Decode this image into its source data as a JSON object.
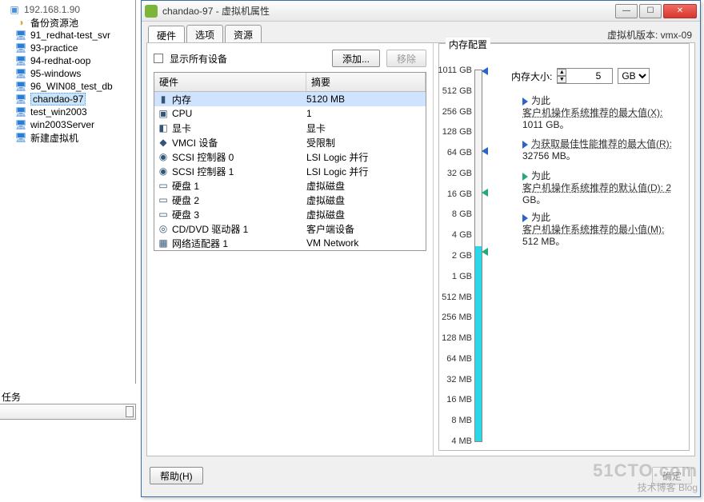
{
  "tree": {
    "root": "192.168.1.90",
    "pool": "备份资源池",
    "vms": [
      {
        "name": "91_redhat-test_svr",
        "sel": false
      },
      {
        "name": "93-practice",
        "sel": false
      },
      {
        "name": "94-redhat-oop",
        "sel": false
      },
      {
        "name": "95-windows",
        "sel": false
      },
      {
        "name": "96_WIN08_test_db",
        "sel": false
      },
      {
        "name": "chandao-97",
        "sel": true
      },
      {
        "name": "test_win2003",
        "sel": false
      },
      {
        "name": "win2003Server",
        "sel": false
      }
    ],
    "newvm": "新建虚拟机"
  },
  "tasks_label": "任务",
  "dialog": {
    "title": "chandao-97 - 虚拟机属性",
    "version": "虚拟机版本: vmx-09",
    "tabs": [
      "硬件",
      "选项",
      "资源"
    ],
    "show_all": "显示所有设备",
    "add_btn": "添加...",
    "remove_btn": "移除",
    "hw_head": [
      "硬件",
      "摘要"
    ],
    "hw": [
      {
        "icon": "mem",
        "name": "内存",
        "sum": "5120 MB",
        "sel": true
      },
      {
        "icon": "cpu",
        "name": "CPU",
        "sum": "1"
      },
      {
        "icon": "vid",
        "name": "显卡",
        "sum": "显卡"
      },
      {
        "icon": "vmci",
        "name": "VMCI 设备",
        "sum": "受限制"
      },
      {
        "icon": "scsi",
        "name": "SCSI 控制器 0",
        "sum": "LSI Logic 并行"
      },
      {
        "icon": "scsi",
        "name": "SCSI 控制器 1",
        "sum": "LSI Logic 并行"
      },
      {
        "icon": "disk",
        "name": "硬盘 1",
        "sum": "虚拟磁盘"
      },
      {
        "icon": "disk",
        "name": "硬盘 2",
        "sum": "虚拟磁盘"
      },
      {
        "icon": "disk",
        "name": "硬盘 3",
        "sum": "虚拟磁盘"
      },
      {
        "icon": "cd",
        "name": "CD/DVD 驱动器 1",
        "sum": "客户端设备"
      },
      {
        "icon": "net",
        "name": "网络适配器 1",
        "sum": "VM Network"
      }
    ],
    "mem": {
      "group": "内存配置",
      "size_label": "内存大小:",
      "size_value": "5",
      "unit": "GB",
      "unit_arrow": "▾",
      "ticks": [
        "1011 GB",
        "512 GB",
        "256 GB",
        "128 GB",
        "64 GB",
        "32 GB",
        "16 GB",
        "8 GB",
        "4 GB",
        "2 GB",
        "1 GB",
        "512 MB",
        "256 MB",
        "128 MB",
        "64 MB",
        "32 MB",
        "16 MB",
        "8 MB",
        "4 MB"
      ],
      "notes": [
        {
          "c": "blue",
          "t1": "为此",
          "t2": "客户机操作系统推荐的最大值(X):",
          "t3": "1011 GB。"
        },
        {
          "c": "blue",
          "t1": "为获取最佳性能推荐的最大值(R):",
          "t2": "32756 MB。",
          "t3": ""
        },
        {
          "c": "green",
          "t1": "为此",
          "t2": "客户机操作系统推荐的默认值(D): 2",
          "t3": "GB。"
        },
        {
          "c": "blue",
          "t1": "为此",
          "t2": "客户机操作系统推荐的最小值(M):",
          "t3": "512 MB。"
        }
      ]
    },
    "help": "帮助(H)",
    "ok": "确定"
  },
  "watermark": "51CTO.com",
  "watermark2": "技术博客 Blog"
}
